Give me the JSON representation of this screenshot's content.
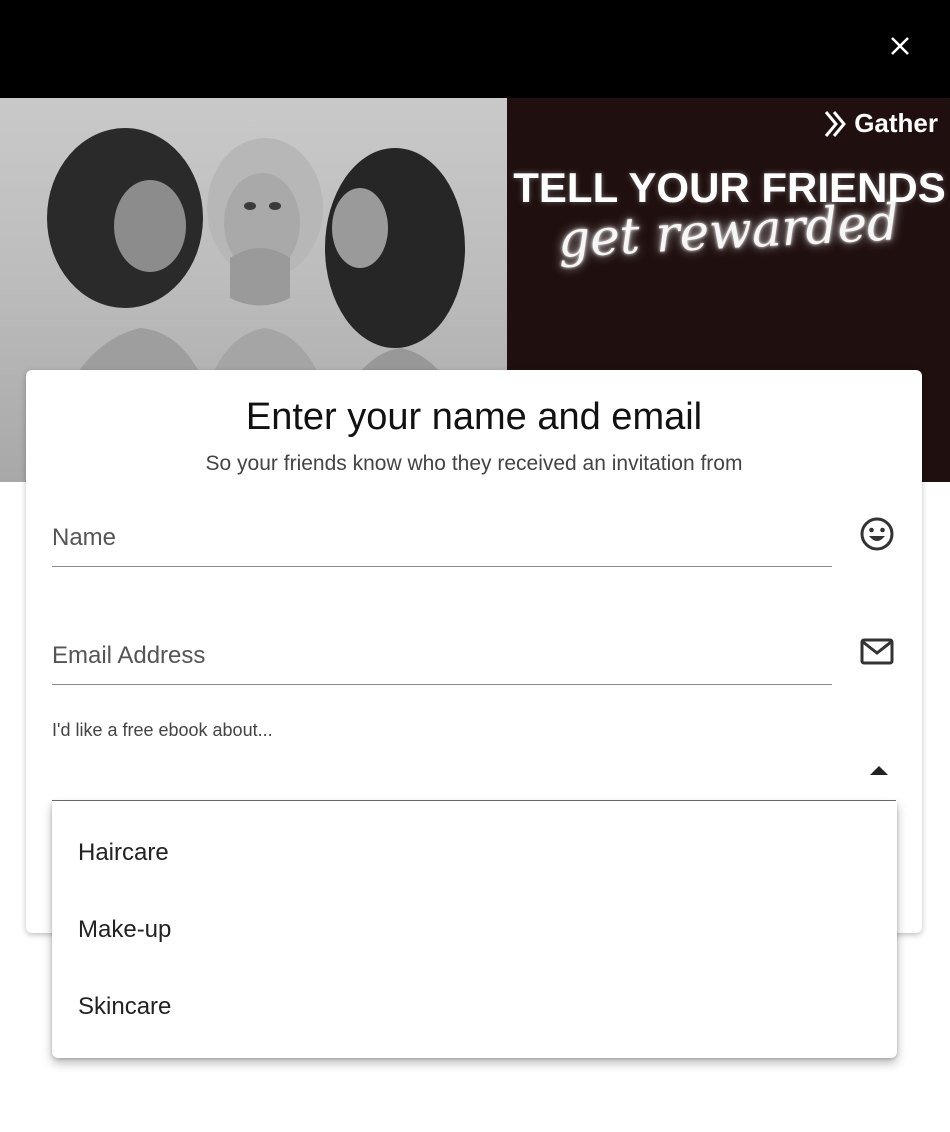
{
  "header": {
    "close_icon": "close-icon"
  },
  "hero": {
    "brand_name": "Gather",
    "headline": "TELL YOUR FRIENDS",
    "subline": "get rewarded"
  },
  "form": {
    "title": "Enter your name and email",
    "subtitle": "So your friends know who they received an invitation from",
    "name": {
      "placeholder": "Name",
      "value": "",
      "icon": "smiley-icon"
    },
    "email": {
      "placeholder": "Email Address",
      "value": "",
      "icon": "mail-icon"
    },
    "ebook": {
      "label": "I'd like a free ebook about...",
      "selected": "",
      "options": [
        "Haircare",
        "Make-up",
        "Skincare"
      ]
    }
  },
  "colors": {
    "topbar": "#000000",
    "brand_panel": "#1f0f0f",
    "text": "#1a1a1a"
  }
}
